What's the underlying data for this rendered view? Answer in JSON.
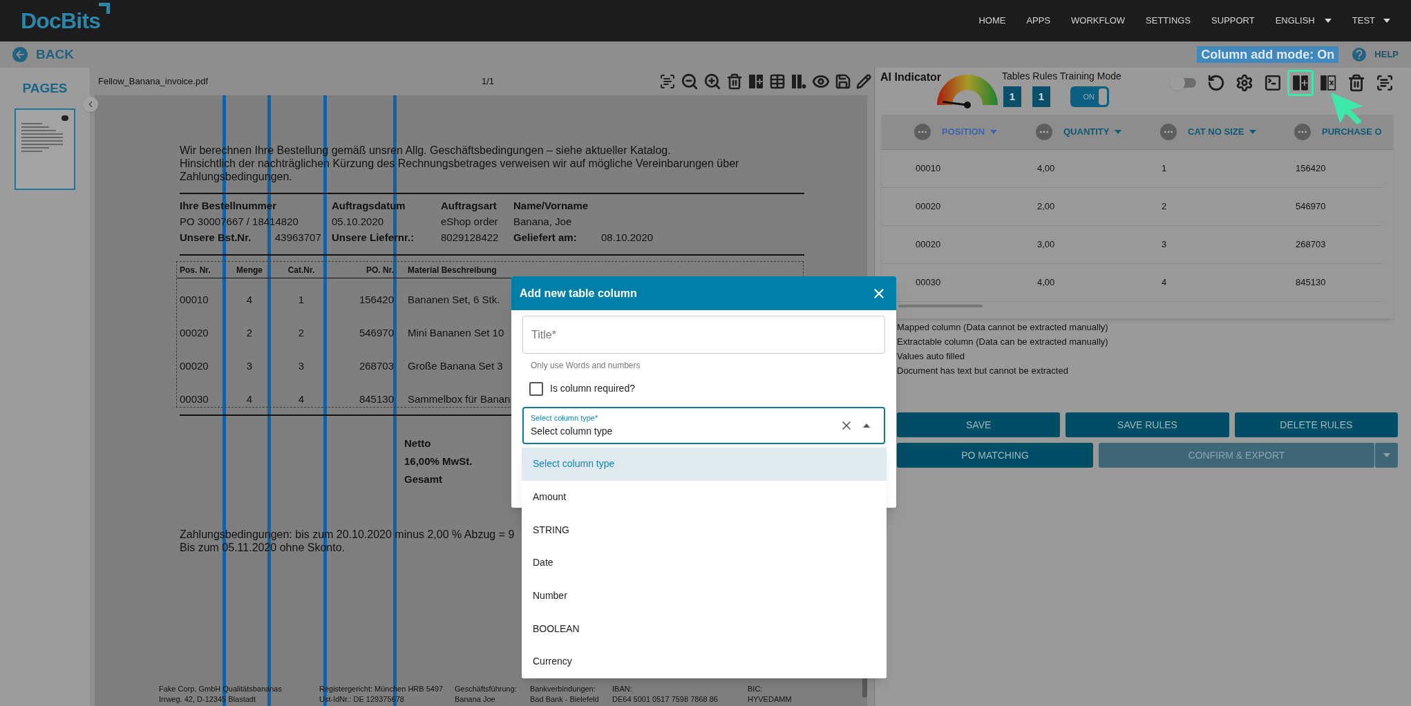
{
  "header": {
    "logo": "DocBits",
    "nav": [
      {
        "label": "HOME"
      },
      {
        "label": "APPS"
      },
      {
        "label": "WORKFLOW"
      },
      {
        "label": "SETTINGS"
      },
      {
        "label": "SUPPORT"
      }
    ],
    "language": "ENGLISH",
    "user": "TEST"
  },
  "subbar": {
    "back": "BACK",
    "mode_badge": "Column add mode: On",
    "help": "HELP"
  },
  "pages_panel": {
    "title": "PAGES",
    "thumbnails": [
      {
        "selected": true
      }
    ]
  },
  "viewer": {
    "filename": "Fellow_Banana_invoice.pdf",
    "page": "1/1",
    "tools": [
      {
        "kind": "ocr"
      },
      {
        "kind": "zoom_out"
      },
      {
        "kind": "zoom_in"
      },
      {
        "kind": "delete"
      },
      {
        "kind": "add_column"
      },
      {
        "kind": "table"
      },
      {
        "kind": "column_chart"
      },
      {
        "kind": "view"
      },
      {
        "kind": "save"
      },
      {
        "kind": "edit"
      }
    ],
    "document": {
      "intro": [
        "Wir berechnen Ihre Bestellung gemäß unsren Allg. Geschäftsbedingungen – siehe aktueller Katalog.",
        "Hinsichtlich der nachträglichen Kürzung des Rechnungsbetrages verweisen wir auf mögliche Vereinbarungen über",
        "Zahlungsbedingungen."
      ],
      "order_info": [
        {
          "kind": "labels",
          "cells": [
            {
              "text": "Ihre Bestellnummer",
              "bold": true
            },
            {
              "text": "Auftragsdatum",
              "bold": true
            },
            {
              "text": "Auftragsart",
              "bold": true
            },
            {
              "text": "Name/Vorname",
              "bold": true
            }
          ]
        },
        {
          "kind": "values",
          "cells": [
            {
              "text": "PO 30007667 / 18414820",
              "bold": false
            },
            {
              "text": "05.10.2020",
              "bold": false
            },
            {
              "text": "eShop order",
              "bold": false
            },
            {
              "text": "Banana, Joe",
              "bold": false
            }
          ]
        },
        {
          "kind": "pairs",
          "cells": [
            {
              "text": "Unsere Bst.Nr.",
              "bold": true
            },
            {
              "text": "43963707",
              "bold": false
            },
            {
              "text": "Unsere Liefernr.:",
              "bold": true
            },
            {
              "text": "8029128422",
              "bold": false
            },
            {
              "text": "Geliefert am:",
              "bold": true
            },
            {
              "text": "08.10.2020",
              "bold": false
            }
          ]
        }
      ],
      "items_columns": [
        "Pos. Nr.",
        "Menge",
        "Cat.Nr.",
        "PO. Nr.",
        "Material Beschreibung"
      ],
      "items": [
        [
          "00010",
          "4",
          "1",
          "156420",
          "Bananen Set, 6 Stk."
        ],
        [
          "00020",
          "2",
          "2",
          "546970",
          "Mini Bananen Set 10"
        ],
        [
          "00020",
          "3",
          "3",
          "268703",
          "Große Banana Set 3"
        ],
        [
          "00030",
          "4",
          "4",
          "845130",
          "Sammelbox für Banan"
        ]
      ],
      "totals": [
        "Netto",
        "16,00% MwSt.",
        "Gesamt"
      ],
      "payment": [
        "Zahlungsbedingungen: bis zum 20.10.2020 minus 2,00 % Abzug = 9",
        "Bis zum 05.11.2020 ohne Skonto."
      ],
      "footer": [
        [
          "Fake Corp. GmbH Qualitätsbananas",
          "Irrweg. 42, D-12345 Blastadt"
        ],
        [
          "Registergericht: München HRB 5497",
          "Ust-IdNr.: DE 129375678"
        ],
        [
          "Geschäftsführung:",
          "Banana Joe"
        ],
        [
          "Bankverbindungen:",
          "Bad Bank - Bielefeld"
        ],
        [
          "IBAN:",
          "DE64 5001 0517 7598 7868 86"
        ],
        [
          "BIC:",
          "HYVEDAMM"
        ]
      ]
    }
  },
  "right_panel": {
    "ai_indicator": {
      "label": "AI Indicator"
    },
    "training": {
      "label": "Tables Rules Training Mode",
      "counts": [
        "1",
        "1"
      ],
      "toggle": {
        "label": "ON",
        "on": true
      }
    },
    "tools": [
      {
        "kind": "switch",
        "on": false
      },
      {
        "kind": "undo",
        "selected": false
      },
      {
        "kind": "settings",
        "selected": false
      },
      {
        "kind": "terminal",
        "selected": false
      },
      {
        "kind": "add_column",
        "selected": true
      },
      {
        "kind": "remove_column",
        "selected": false
      },
      {
        "kind": "delete",
        "selected": false
      },
      {
        "kind": "ocr",
        "selected": false
      }
    ],
    "table": {
      "columns": [
        {
          "label": "POSITION",
          "selected": true
        },
        {
          "label": "QUANTITY",
          "selected": false
        },
        {
          "label": "CAT NO SIZE",
          "selected": false
        },
        {
          "label": "PURCHASE O",
          "selected": false
        }
      ],
      "rows": [
        [
          "00010",
          "4,00",
          "1",
          "156420"
        ],
        [
          "00020",
          "2,00",
          "2",
          "546970"
        ],
        [
          "00020",
          "3,00",
          "3",
          "268703"
        ],
        [
          "00030",
          "4,00",
          "4",
          "845130"
        ]
      ]
    },
    "legend": [
      "Mapped column (Data cannot be extracted manually)",
      "Extractable column (Data can be extracted manually)",
      "Values auto filled",
      "Document has text but cannot be extracted"
    ],
    "buttons": [
      {
        "label": "SAVE",
        "disabled": false
      },
      {
        "label": "SAVE RULES",
        "disabled": false
      },
      {
        "label": "DELETE RULES",
        "disabled": false
      }
    ],
    "buttons_2": [
      {
        "label": "PO MATCHING",
        "disabled": false
      },
      {
        "label": "CONFIRM & EXPORT",
        "disabled": true
      }
    ]
  },
  "modal": {
    "title": "Add new table column",
    "title_field": {
      "placeholder": "Title*"
    },
    "hint": "Only use Words and numbers",
    "required": {
      "label": "Is column required?",
      "checked": false
    },
    "type_select": {
      "label": "Select column type*",
      "value": "Select column type",
      "expanded": true,
      "options": [
        {
          "label": "Select column type",
          "selected": true
        },
        {
          "label": "Amount",
          "selected": false
        },
        {
          "label": "STRING",
          "selected": false
        },
        {
          "label": "Date",
          "selected": false
        },
        {
          "label": "Number",
          "selected": false
        },
        {
          "label": "BOOLEAN",
          "selected": false
        },
        {
          "label": "Currency",
          "selected": false
        }
      ]
    }
  }
}
